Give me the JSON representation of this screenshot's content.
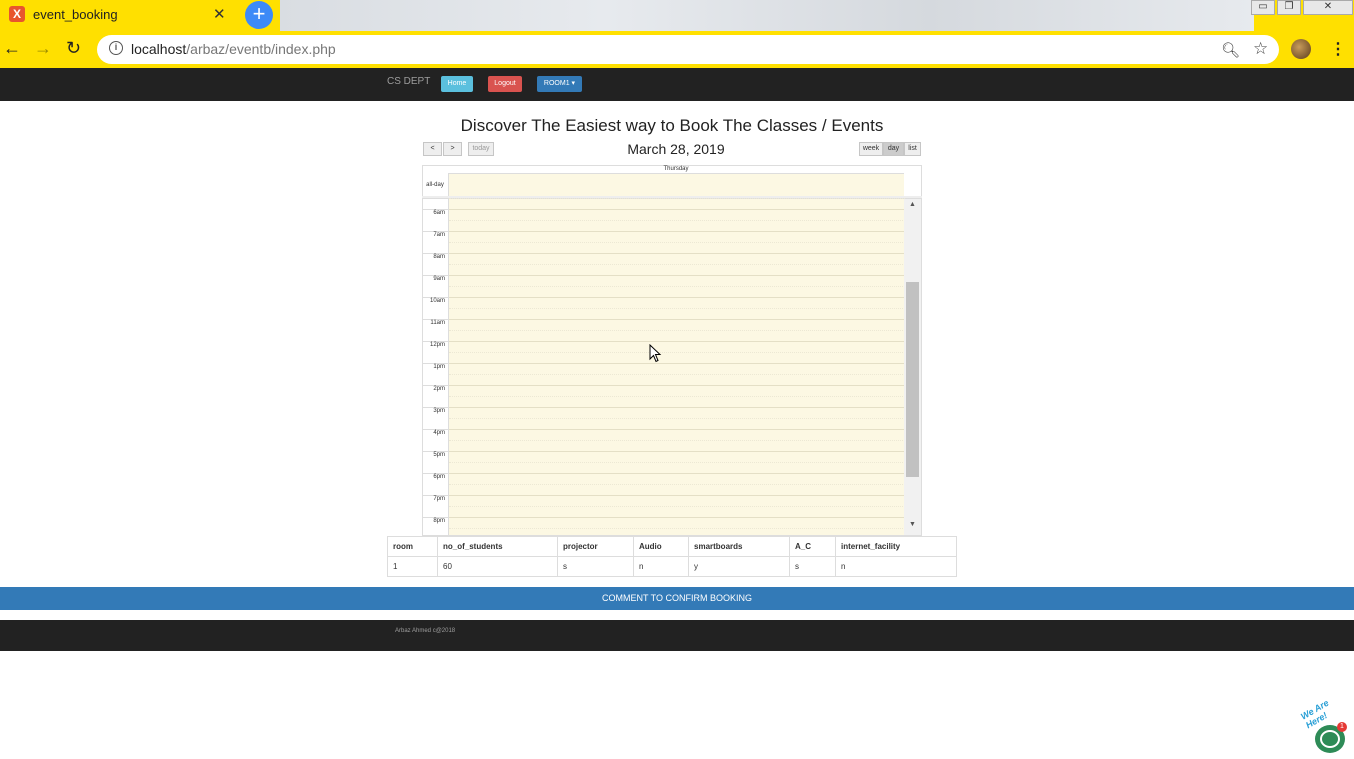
{
  "browser": {
    "tab_title": "event_booking",
    "tab_favicon": "X",
    "url_host": "localhost",
    "url_path": "/arbaz/eventb/index.php",
    "icons": [
      "back-icon",
      "forward-icon",
      "reload-icon",
      "info-icon",
      "zoom-icon",
      "star-icon",
      "menu-icon"
    ]
  },
  "navbar": {
    "brand": "CS DEPT",
    "home": "Home",
    "logout": "Logout",
    "room": "ROOM1 ▾"
  },
  "page": {
    "title": "Discover The Easiest way to Book The Classes / Events"
  },
  "calendar": {
    "prev": "<",
    "next": ">",
    "today": "today",
    "date": "March 28, 2019",
    "views": {
      "week": "week",
      "day": "day",
      "list": "list"
    },
    "active_view": "day",
    "day_name": "Thursday",
    "allday": "all-day",
    "times": [
      "6am",
      "7am",
      "8am",
      "9am",
      "10am",
      "11am",
      "12pm",
      "1pm",
      "2pm",
      "3pm",
      "4pm",
      "5pm",
      "6pm",
      "7pm",
      "8pm"
    ]
  },
  "room_table": {
    "headers": [
      "room",
      "no_of_students",
      "projector",
      "Audio",
      "smartboards",
      "A_C",
      "internet_facility"
    ],
    "row": [
      "1",
      "60",
      "s",
      "n",
      "y",
      "s",
      "n"
    ]
  },
  "confirm": "COMMENT TO CONFIRM BOOKING",
  "footer": "Arbaz Ahmed c@2018",
  "chat": {
    "text": "We Are Here!",
    "badge": "1"
  },
  "colors": {
    "chrome": "#ffe000",
    "navbar": "#222222",
    "home_btn": "#5bc0de",
    "logout_btn": "#d9534f",
    "room_btn": "#337ab7",
    "calendar_bg": "#fcf8e3",
    "confirm_bar": "#337ab7"
  }
}
